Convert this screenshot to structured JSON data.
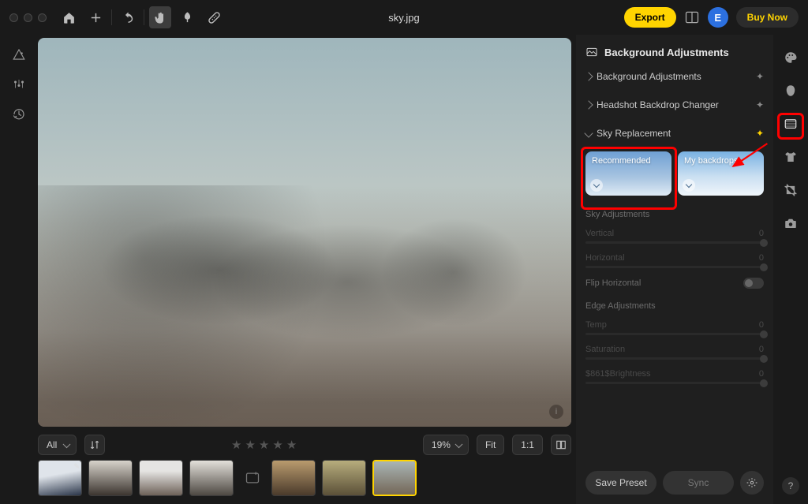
{
  "titlebar": {
    "file_name": "sky.jpg",
    "export_label": "Export",
    "buy_label": "Buy Now",
    "avatar_letter": "E"
  },
  "filter_bar": {
    "filter_label": "All",
    "zoom_label": "19%",
    "fit_label": "Fit",
    "ratio_label": "1:1"
  },
  "panel": {
    "title": "Background Adjustments",
    "rows": {
      "bg_adjust": "Background Adjustments",
      "headshot": "Headshot Backdrop Changer",
      "sky_repl": "Sky Replacement"
    },
    "cards": {
      "recommended": "Recommended",
      "my": "My backdrops"
    },
    "sections": {
      "sky_adjust": "Sky Adjustments",
      "edge_adjust": "Edge Adjustments"
    },
    "sliders": {
      "vertical": {
        "label": "Vertical",
        "value": "0"
      },
      "horizontal": {
        "label": "Horizontal",
        "value": "0"
      },
      "flip_h": "Flip Horizontal",
      "temp": {
        "label": "Temp",
        "value": "0"
      },
      "saturation": {
        "label": "Saturation",
        "value": "0"
      },
      "brightness": {
        "label": "$861$Brightness",
        "value": "0"
      }
    },
    "footer": {
      "save_preset": "Save Preset",
      "sync": "Sync"
    }
  }
}
